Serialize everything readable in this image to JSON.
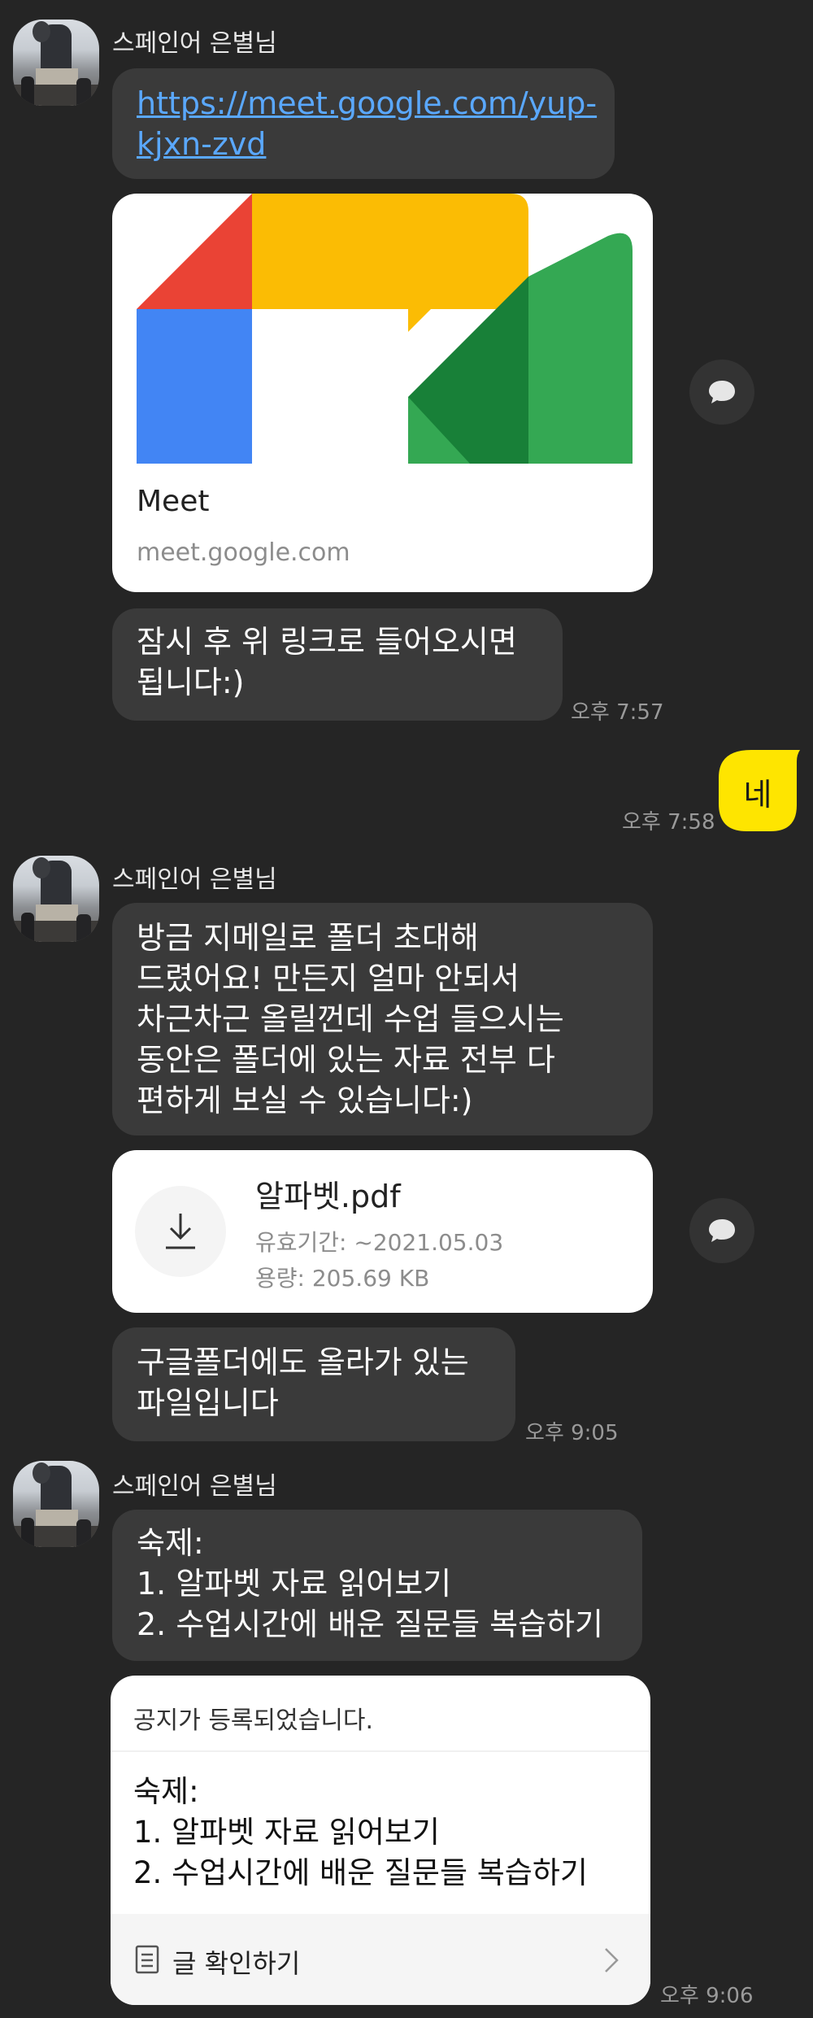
{
  "chat": {
    "sender_name": "스페인어 은별님",
    "group1": {
      "link_line1": "https://meet.google.com/yup-",
      "link_line2": "kjxn-zvd",
      "preview_title": "Meet",
      "preview_domain": "meet.google.com",
      "message_line1": "잠시 후 위 링크로 들어오시면",
      "message_line2": "됩니다:)",
      "time": "오후 7:57"
    },
    "my_reply": {
      "text": "네",
      "time": "오후 7:58"
    },
    "group2": {
      "message_lines": [
        "방금 지메일로 폴더 초대해",
        "드렸어요! 만든지 얼마 안되서",
        "차근차근 올릴껀데 수업 들으시는",
        "동안은 폴더에 있는 자료 전부 다",
        "편하게 보실 수 있습니다:)"
      ],
      "file_name": "알파벳.pdf",
      "file_expiry": "유효기간: ~2021.05.03",
      "file_size": "용량: 205.69 KB",
      "message2_line1": "구글폴더에도 올라가 있는",
      "message2_line2": "파일입니다",
      "time": "오후 9:05"
    },
    "group3": {
      "message_lines": [
        "숙제:",
        "1. 알파벳 자료 읽어보기",
        "2. 수업시간에 배운 질문들 복습하기"
      ],
      "notice_header": "공지가 등록되었습니다.",
      "notice_lines": [
        "숙제:",
        "1. 알파벳 자료 읽어보기",
        "2. 수업시간에 배운 질문들 복습하기"
      ],
      "notice_action": "글 확인하기",
      "time": "오후 9:06"
    }
  },
  "colors": {
    "background": "#252525",
    "bubble_incoming": "#3a3a3a",
    "bubble_outgoing": "#fee500",
    "link": "#5aa8ff",
    "meet_red": "#ea4335",
    "meet_yellow": "#fbbc04",
    "meet_blue": "#4285f4",
    "meet_green": "#34a853",
    "meet_dark_green": "#188038"
  },
  "icons": [
    "avatar",
    "share-icon",
    "download-icon",
    "document-icon",
    "chevron-right-icon",
    "google-meet-logo"
  ]
}
